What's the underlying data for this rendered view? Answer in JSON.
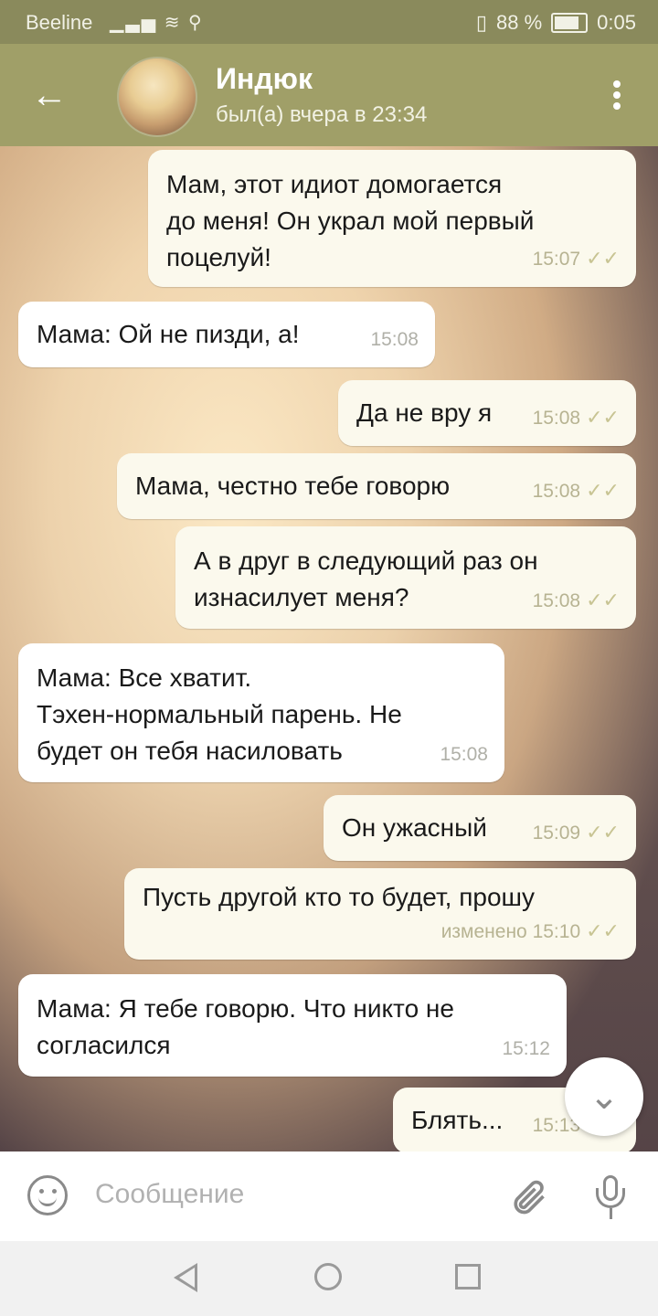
{
  "status": {
    "carrier": "Beeline",
    "battery": "88 %",
    "time": "0:05"
  },
  "header": {
    "title": "Индюк",
    "subtitle": "был(а) вчера в 23:34"
  },
  "messages": [
    {
      "dir": "out",
      "text": "Мам, этот идиот домогается\nдо меня! Он украл мой первый\nпоцелуй!",
      "time": "15:07"
    },
    {
      "dir": "in",
      "text": "Мама: Ой не пизди, а!",
      "time": "15:08"
    },
    {
      "dir": "out",
      "text": "Да не вру я",
      "time": "15:08"
    },
    {
      "dir": "out",
      "text": "Мама, честно тебе говорю",
      "time": "15:08"
    },
    {
      "dir": "out",
      "text": "А в друг в следующий раз он\nизнасилует меня?",
      "time": "15:08"
    },
    {
      "dir": "in",
      "text": "Мама: Все хватит.\nТэхен-нормальный парень. Не\nбудет он тебя насиловать",
      "time": "15:08"
    },
    {
      "dir": "out",
      "text": "Он ужасный",
      "time": "15:09"
    },
    {
      "dir": "out",
      "text": "Пусть другой кто то будет, прошу",
      "time": "изменено 15:10"
    },
    {
      "dir": "in",
      "text": "Мама: Я тебе говорю. Что никто не\nсогласился",
      "time": "15:12"
    },
    {
      "dir": "out",
      "text": "Блять...",
      "time": "15:13"
    }
  ],
  "input": {
    "placeholder": "Сообщение"
  },
  "icons": {
    "check": "✓✓",
    "back": "←",
    "chevron": "⌄"
  }
}
